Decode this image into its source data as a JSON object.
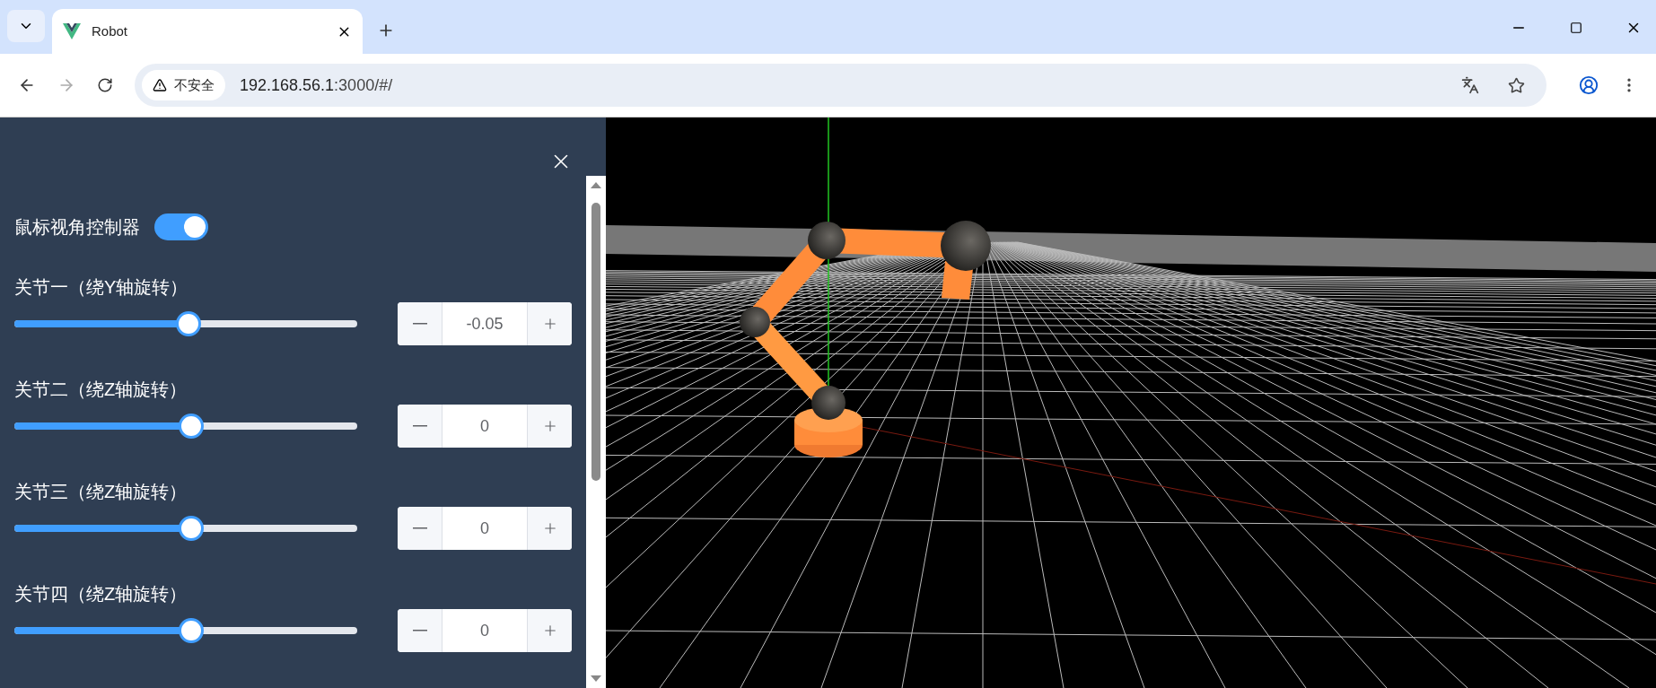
{
  "browser": {
    "tab": {
      "title": "Robot"
    },
    "address": {
      "security_label": "不安全",
      "url_host": "192.168.56.1",
      "url_rest": ":3000/#/"
    }
  },
  "panel": {
    "toggle": {
      "label": "鼠标视角控制器",
      "on": true
    },
    "joints": [
      {
        "label": "关节一（绕Y轴旋转）",
        "level": 0.49,
        "value": "-0.05"
      },
      {
        "label": "关节二（绕Z轴旋转）",
        "level": 0.5,
        "value": "0"
      },
      {
        "label": "关节三（绕Z轴旋转）",
        "level": 0.5,
        "value": "0"
      },
      {
        "label": "关节四（绕Z轴旋转）",
        "level": 0.5,
        "value": "0"
      }
    ]
  }
}
